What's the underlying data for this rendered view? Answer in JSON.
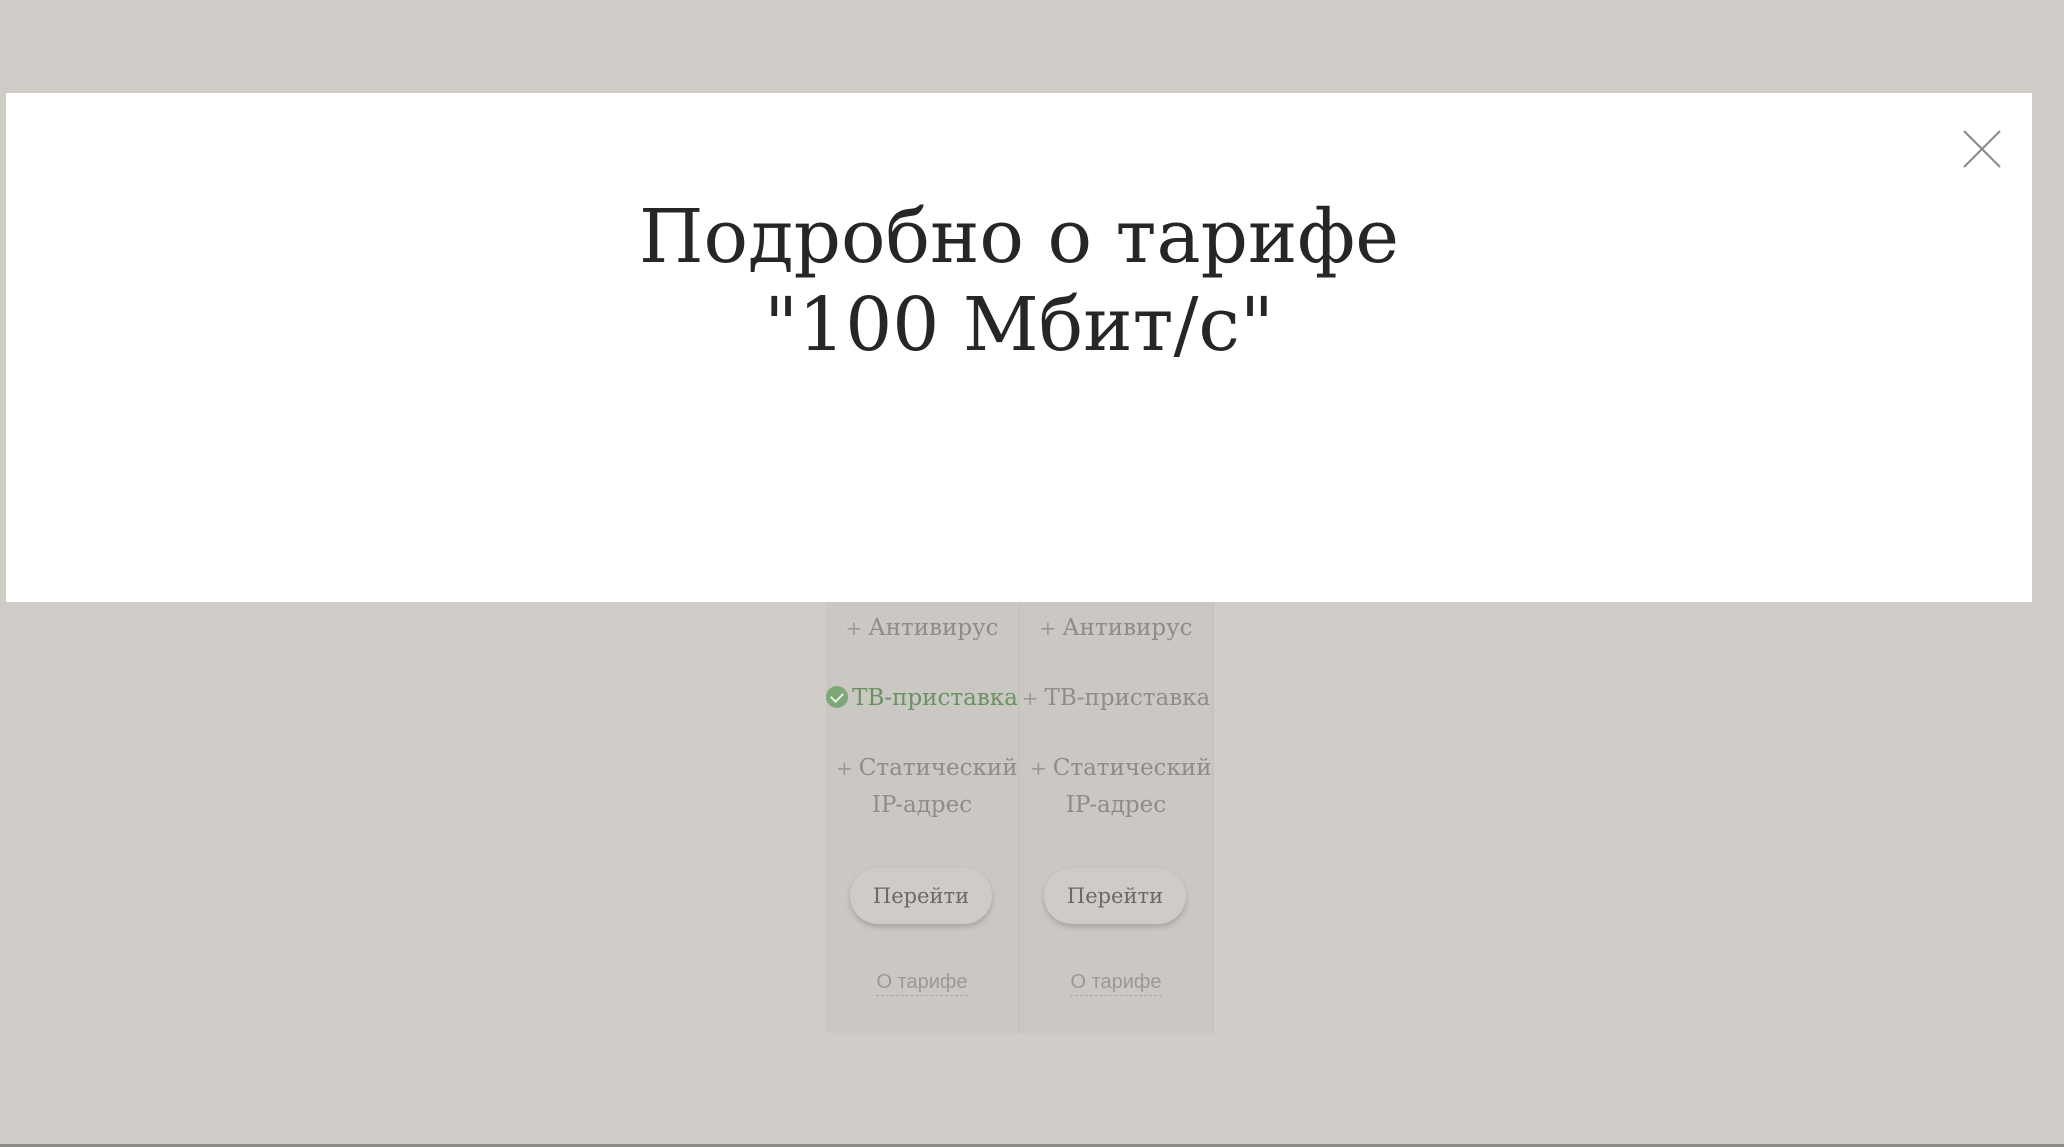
{
  "modal": {
    "title": "Подробно о тарифе \"100 Мбит/с\"",
    "close_icon": "close-icon"
  },
  "tariff_columns": [
    {
      "features": [
        {
          "label": "Антивирус",
          "included": false
        },
        {
          "label": "ТВ-приставка",
          "included": true
        },
        {
          "label": "Статический IP-адрес",
          "included": false
        }
      ],
      "go_button": "Перейти",
      "about_link": "О тарифе"
    },
    {
      "features": [
        {
          "label": "Антивирус",
          "included": false
        },
        {
          "label": "ТВ-приставка",
          "included": false
        },
        {
          "label": "Статический IP-адрес",
          "included": false
        }
      ],
      "go_button": "Перейти",
      "about_link": "О тарифе"
    }
  ],
  "colors": {
    "overlay_background": "#cfccc7",
    "modal_background": "#ffffff",
    "included_feature": "#6b9264",
    "title_text": "#262626"
  }
}
